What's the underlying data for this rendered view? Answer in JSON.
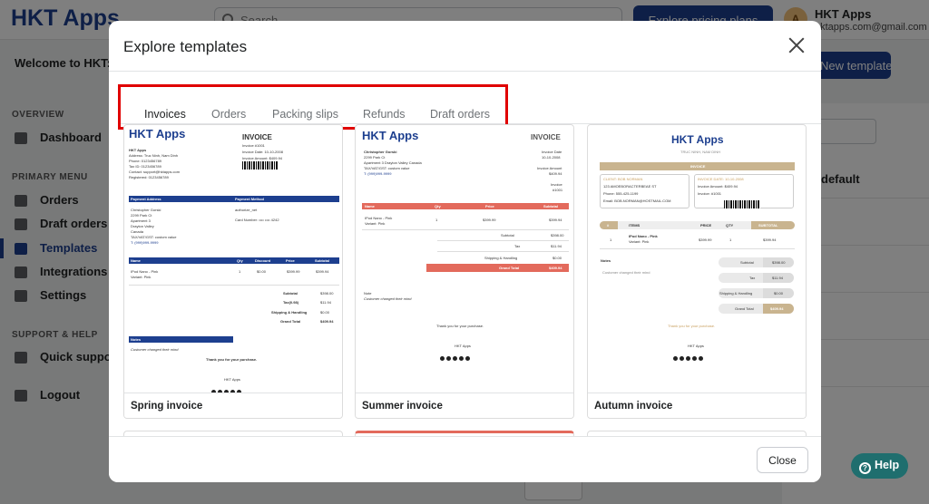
{
  "app": {
    "brand": "HKT Apps",
    "search_placeholder": "Search",
    "pricing_button": "Explore pricing plans",
    "account_name": "HKT Apps",
    "account_email": "hktapps.com@gmail.com",
    "avatar_letter": "A",
    "welcome": "Welcome to HKT: Order Printer",
    "new_template": "New template",
    "default_label": "default"
  },
  "sidebar": {
    "overview_header": "OVERVIEW",
    "primary_header": "PRIMARY MENU",
    "support_header": "SUPPORT & HELP",
    "items": [
      {
        "label": "Dashboard",
        "icon": "home-icon"
      },
      {
        "label": "Orders",
        "icon": "inbox-icon"
      },
      {
        "label": "Draft orders",
        "icon": "edit-icon"
      },
      {
        "label": "Templates",
        "icon": "printer-icon"
      },
      {
        "label": "Integrations",
        "icon": "plug-icon"
      },
      {
        "label": "Settings",
        "icon": "gear-icon"
      },
      {
        "label": "Quick support",
        "icon": "chat-icon"
      },
      {
        "label": "Logout",
        "icon": "logout-icon"
      }
    ]
  },
  "modal": {
    "title": "Explore templates",
    "tabs": [
      "Invoices",
      "Orders",
      "Packing slips",
      "Refunds",
      "Draft orders"
    ],
    "active_tab": "Invoices",
    "close_label": "Close",
    "templates": [
      {
        "name": "Spring invoice",
        "accent": "#1d3f8f",
        "logo": "HKT Apps",
        "heading": "INVOICE",
        "shop_lines": [
          "HKT Apps",
          "Address: Truc Ninh, Nam Dinh",
          "Phone: 0123456789",
          "Tax ID: 0123456789",
          "Contact: support@hktapps.com",
          "Registered: 0123456789"
        ],
        "meta_lines": [
          "Invoice #1001",
          "Invoice Date: 10-10-2008",
          "Invoice Amount: $409.94"
        ],
        "address_header": "Payment Address",
        "method_header": "Payment Method",
        "address_lines": [
          "Christopher Gorski",
          "2299 Park Ct",
          "Apartment 3",
          "Drayton Valley",
          "Canada",
          "TAX/VAT/GST: custom value",
          "T: (999)999-9999"
        ],
        "method_lines": [
          "authorize_net",
          "Card Number: •••• •••• 4242"
        ],
        "item_cols": [
          "Name",
          "Qty",
          "Discount",
          "Price",
          "Subtotal"
        ],
        "item_row": [
          "IPod Nano - Pink",
          "1",
          "$0.00",
          "$399.99",
          "$399.94"
        ],
        "item_variant": "Variant: Pink",
        "totals": [
          [
            "Subtotal",
            "$398.00"
          ],
          [
            "Tax(0.98)",
            "$11.94"
          ],
          [
            "Shipping & Handling",
            "$0.00"
          ],
          [
            "Grand Total",
            "$409.94"
          ]
        ],
        "notes_header": "Notes",
        "notes_text": "Customer changed their mind",
        "thanks": "Thank you for your purchase.",
        "footer_brand": "HKT Apps"
      },
      {
        "name": "Summer invoice",
        "accent": "#e36a5c",
        "logo": "HKT Apps",
        "heading": "INVOICE",
        "meta_lines": [
          "Invoice Date",
          "10-10-2008",
          "Invoice Amount",
          "$409.94",
          "Invoice",
          "#1001"
        ],
        "address_lines": [
          "Christopher Gorski",
          "2299 Park Ct",
          "Apartment 3 Drayton Valley Canada",
          "TAX/VAT/GST: custom value",
          "T: (999)999-9999"
        ],
        "item_cols": [
          "Name",
          "Qty",
          "Price",
          "Subtotal"
        ],
        "item_row": [
          "IPod Nano - Pink",
          "1",
          "$399.99",
          "$399.94"
        ],
        "item_variant": "Variant: Pink",
        "totals": [
          [
            "Subtotal",
            "$398.00"
          ],
          [
            "Tax",
            "$11.94"
          ],
          [
            "Shipping & Handling",
            "$0.00"
          ],
          [
            "Grand Total",
            "$409.94"
          ]
        ],
        "notes_header": "Note",
        "notes_text": "Customer changed their mind",
        "thanks": "Thank you for your purchase.",
        "footer_brand": "HKT Apps"
      },
      {
        "name": "Autumn invoice",
        "accent": "#c9b48f",
        "logo": "HKT Apps",
        "subtitle": "TRUC NINH, NAM DINH",
        "heading": "INVOICE",
        "client_lines": [
          "CLIENT: BOB NORMAN",
          "123 AMOEBORACTERBEAE ST",
          "Phone: 555-425-1199",
          "Email: BOB.NORMAN@HOSTMAIL.COM"
        ],
        "meta_lines": [
          "INVOICE DATE: 10-10-2008",
          "Invoice Amount: $409.94",
          "Invoice: #1001"
        ],
        "item_cols": [
          "#",
          "ITEMS",
          "PRICE",
          "QTY",
          "SUBTOTAL"
        ],
        "item_row": [
          "1",
          "IPod Nano - Pink",
          "$399.99",
          "1",
          "$399.94"
        ],
        "item_variant": "Variant: Pink",
        "totals": [
          [
            "Subtotal",
            "$398.00"
          ],
          [
            "Tax",
            "$11.94"
          ],
          [
            "Shipping & Handling",
            "$0.00"
          ],
          [
            "Grand Total",
            "$409.94"
          ]
        ],
        "notes_header": "Notes",
        "notes_text": "Customer changed their mind",
        "thanks": "Thank you for your purchase.",
        "footer_brand": "HKT Apps"
      }
    ]
  },
  "help": {
    "label": "Help"
  }
}
